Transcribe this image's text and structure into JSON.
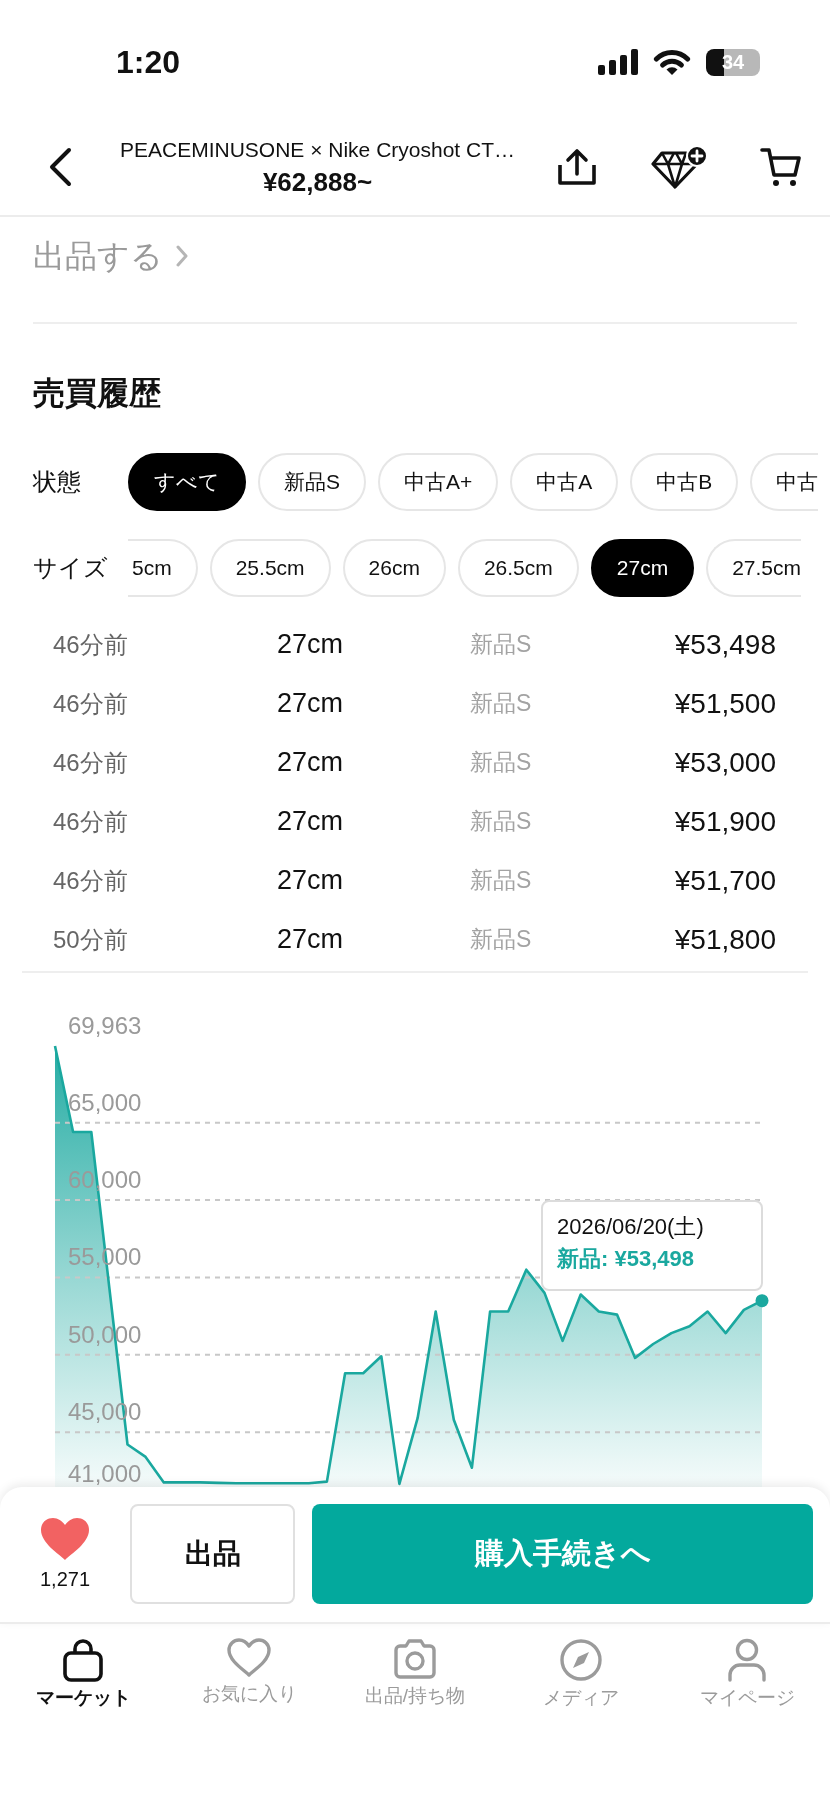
{
  "status_bar": {
    "time": "1:20",
    "battery": "34"
  },
  "header": {
    "title": "PEACEMINUSONE × Nike Cryoshot CT…",
    "price": "¥62,888~"
  },
  "sell_link": "出品する",
  "history": {
    "title": "売買履歴",
    "filters": [
      {
        "label": "状態",
        "options": [
          {
            "label": "すべて",
            "selected": true
          },
          {
            "label": "新品S",
            "selected": false
          },
          {
            "label": "中古A+",
            "selected": false
          },
          {
            "label": "中古A",
            "selected": false
          },
          {
            "label": "中古B",
            "selected": false
          },
          {
            "label": "中古",
            "selected": false
          }
        ]
      },
      {
        "label": "サイズ",
        "options": [
          {
            "label": "5cm",
            "selected": false
          },
          {
            "label": "25.5cm",
            "selected": false
          },
          {
            "label": "26cm",
            "selected": false
          },
          {
            "label": "26.5cm",
            "selected": false
          },
          {
            "label": "27cm",
            "selected": true
          },
          {
            "label": "27.5cm",
            "selected": false
          }
        ]
      }
    ],
    "rows": [
      {
        "time": "46分前",
        "size": "27cm",
        "condition": "新品S",
        "price": "¥53,498"
      },
      {
        "time": "46分前",
        "size": "27cm",
        "condition": "新品S",
        "price": "¥51,500"
      },
      {
        "time": "46分前",
        "size": "27cm",
        "condition": "新品S",
        "price": "¥53,000"
      },
      {
        "time": "46分前",
        "size": "27cm",
        "condition": "新品S",
        "price": "¥51,900"
      },
      {
        "time": "46分前",
        "size": "27cm",
        "condition": "新品S",
        "price": "¥51,700"
      },
      {
        "time": "50分前",
        "size": "27cm",
        "condition": "新品S",
        "price": "¥51,800"
      }
    ],
    "chart_data": {
      "type": "area",
      "grid": true,
      "categories": [
        null,
        null,
        null,
        null,
        null,
        null,
        null,
        null,
        null,
        null,
        null,
        null,
        null,
        null,
        null,
        null,
        null,
        null,
        null,
        null,
        null,
        null,
        null,
        null,
        null,
        null,
        null,
        null,
        null,
        null,
        null,
        null,
        null,
        null,
        null,
        null,
        null,
        null,
        null,
        null
      ],
      "ylim": [
        41000,
        69963
      ],
      "yticks": [
        {
          "value": 69963,
          "label": "69,963"
        },
        {
          "value": 65000,
          "label": "65,000"
        },
        {
          "value": 60000,
          "label": "60,000"
        },
        {
          "value": 55000,
          "label": "55,000"
        },
        {
          "value": 50000,
          "label": "50,000"
        },
        {
          "value": 45000,
          "label": "45,000"
        },
        {
          "value": 41000,
          "label": "41,000"
        }
      ],
      "series": [
        {
          "color": "#1aa89f",
          "values": [
            69963,
            64400,
            64400,
            54300,
            44200,
            43400,
            41750,
            41750,
            41750,
            41720,
            41700,
            41700,
            41700,
            41700,
            41700,
            41800,
            48800,
            48800,
            49900,
            41650,
            45900,
            52800,
            45800,
            42700,
            52800,
            52800,
            55500,
            54000,
            50900,
            53900,
            52800,
            52600,
            49800,
            50700,
            51400,
            51850,
            52800,
            51400,
            52900,
            53498
          ]
        }
      ]
    },
    "tooltip": {
      "date": "2026/06/20(土)",
      "price": "新品: ¥53,498"
    }
  },
  "action_bar": {
    "likes": "1,271",
    "sell_button": "出品",
    "buy_button": "購入手続きへ"
  },
  "tab_bar": [
    {
      "label": "マーケット",
      "selected": true
    },
    {
      "label": "お気に入り",
      "selected": false
    },
    {
      "label": "出品/持ち物",
      "selected": false
    },
    {
      "label": "メディア",
      "selected": false
    },
    {
      "label": "マイページ",
      "selected": false
    }
  ]
}
